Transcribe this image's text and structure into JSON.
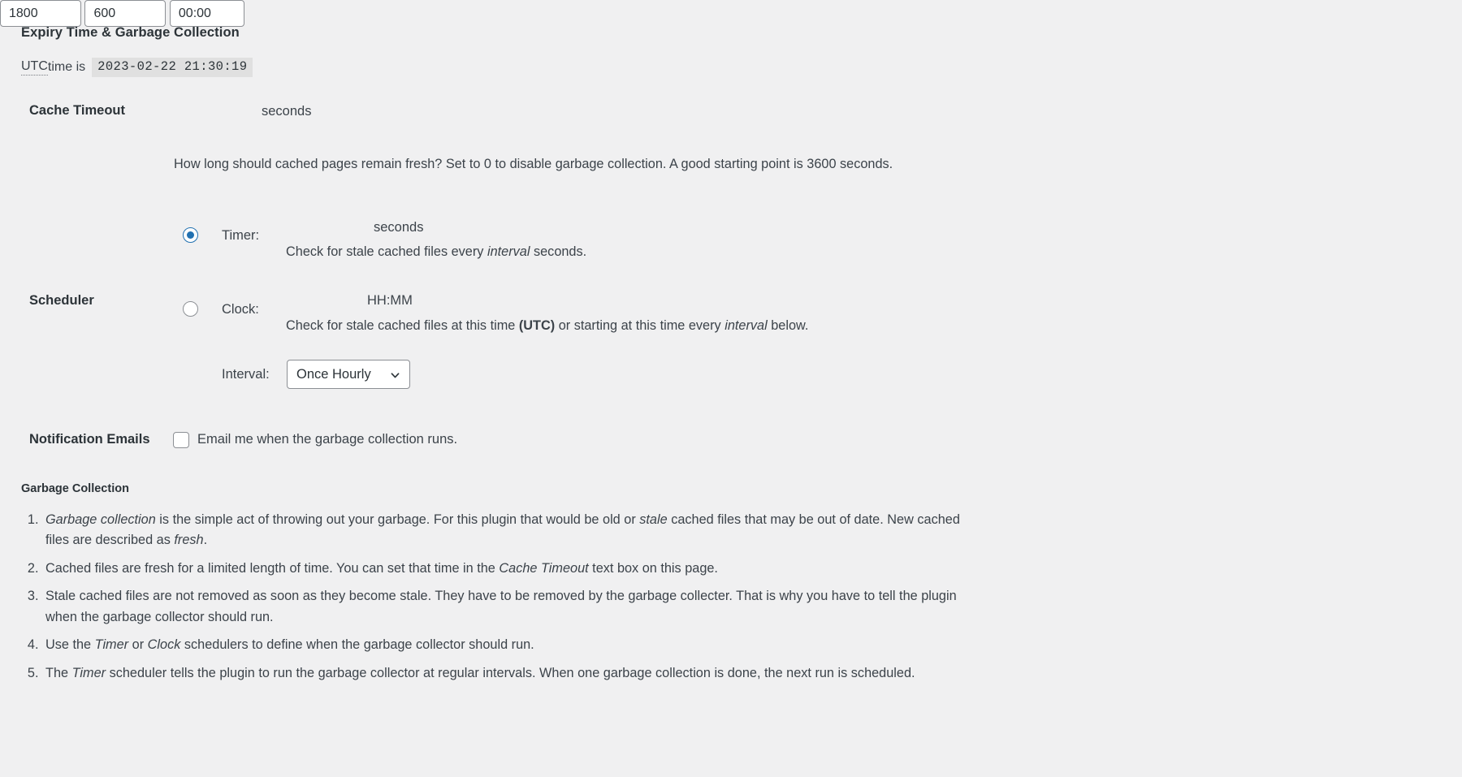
{
  "section": {
    "title": "Expiry Time & Garbage Collection"
  },
  "utc": {
    "abbr": "UTC",
    "text_before": " time is",
    "time_value": "2023-02-22 21:30:19"
  },
  "cache_timeout": {
    "label": "Cache Timeout",
    "value": "1800",
    "placeholder": "",
    "unit": "seconds",
    "description": "How long should cached pages remain fresh? Set to 0 to disable garbage collection. A good starting point is 3600 seconds."
  },
  "scheduler": {
    "label": "Scheduler",
    "timer": {
      "radio_checked": true,
      "label": "Timer:",
      "value": "600",
      "placeholder": "",
      "unit": "seconds",
      "desc_part1": "Check for stale cached files every ",
      "desc_em": "interval",
      "desc_part2": " seconds."
    },
    "clock": {
      "radio_checked": false,
      "label": "Clock:",
      "value": "00:00",
      "placeholder": "",
      "unit": "HH:MM",
      "desc_part1": "Check for stale cached files at this time ",
      "desc_strong": "(UTC)",
      "desc_part2": " or starting at this time every ",
      "desc_em": "interval",
      "desc_part3": " below."
    },
    "interval": {
      "label": "Interval:",
      "selected": "Once Hourly",
      "options": [
        "Once Hourly"
      ],
      "chevron_icon": "chevron-down-icon"
    }
  },
  "notification": {
    "label": "Notification Emails",
    "checkbox_checked": false,
    "checkbox_label": "Email me when the garbage collection runs."
  },
  "garbage_collection": {
    "title": "Garbage Collection",
    "items": [
      {
        "parts": [
          {
            "t": "Garbage collection",
            "em": true
          },
          {
            "t": " is the simple act of throwing out your garbage. For this plugin that would be old or "
          },
          {
            "t": "stale",
            "em": true
          },
          {
            "t": " cached files that may be out of date. New cached files are described as "
          },
          {
            "t": "fresh",
            "em": true
          },
          {
            "t": "."
          }
        ]
      },
      {
        "parts": [
          {
            "t": "Cached files are fresh for a limited length of time. You can set that time in the "
          },
          {
            "t": "Cache Timeout",
            "em": true
          },
          {
            "t": " text box on this page."
          }
        ]
      },
      {
        "parts": [
          {
            "t": "Stale cached files are not removed as soon as they become stale. They have to be removed by the garbage collecter. That is why you have to tell the plugin when the garbage collector should run."
          }
        ]
      },
      {
        "parts": [
          {
            "t": "Use the "
          },
          {
            "t": "Timer",
            "em": true
          },
          {
            "t": " or "
          },
          {
            "t": "Clock",
            "em": true
          },
          {
            "t": " schedulers to define when the garbage collector should run."
          }
        ]
      },
      {
        "parts": [
          {
            "t": "The "
          },
          {
            "t": "Timer",
            "em": true
          },
          {
            "t": " scheduler tells the plugin to run the garbage collector at regular intervals. When one garbage collection is done, the next run is scheduled."
          }
        ]
      }
    ]
  },
  "colors": {
    "page_bg": "#f0f0f1",
    "accent": "#2271b1",
    "text": "#3c434a",
    "heading": "#2c3338",
    "border": "#8c8f94",
    "code_bg": "#e0e0e0"
  }
}
